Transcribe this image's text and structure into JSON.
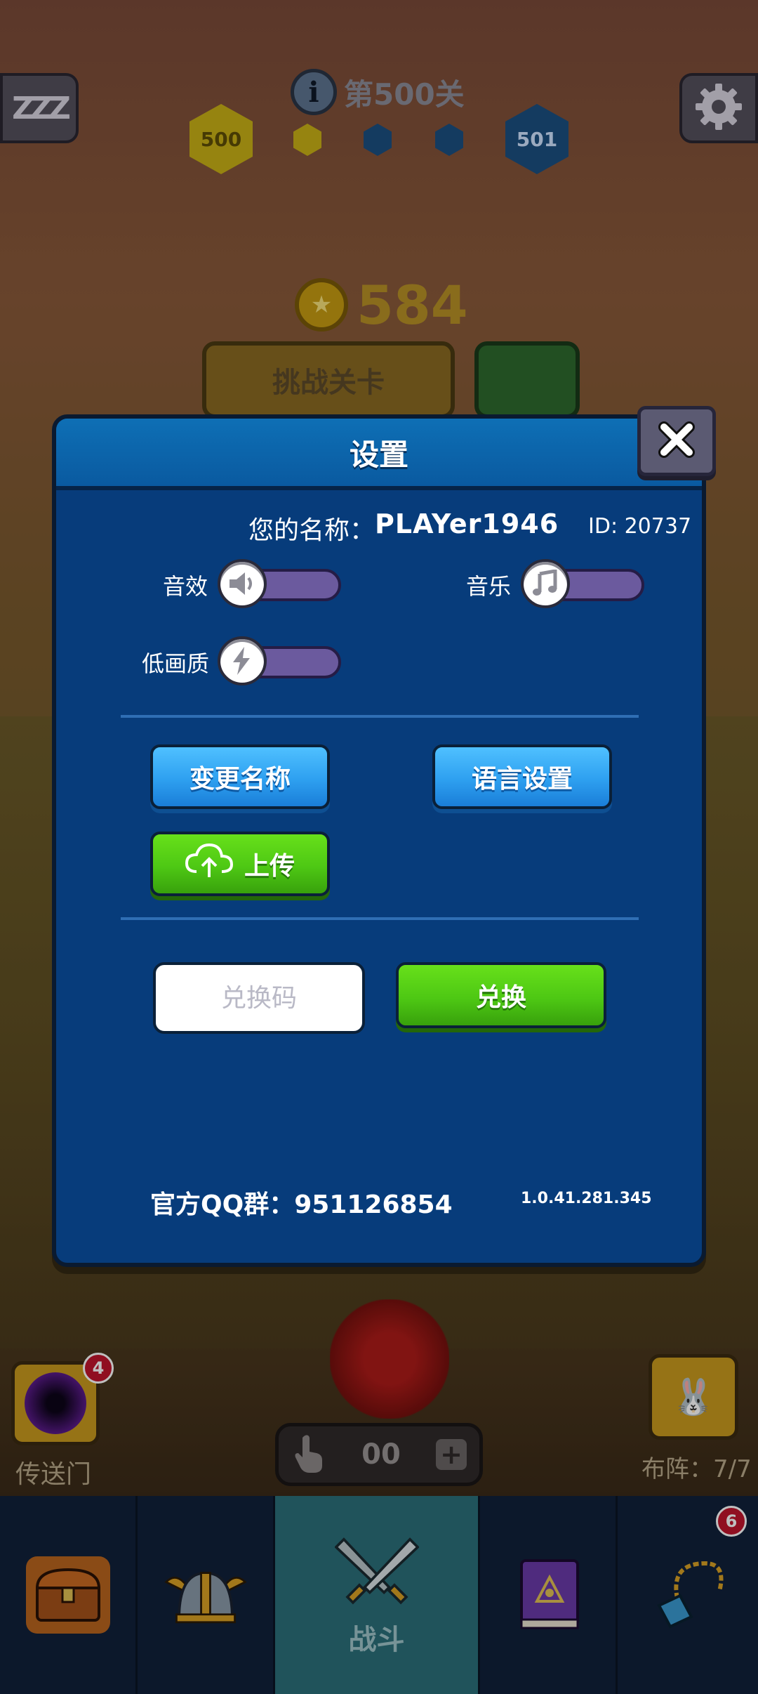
{
  "hud": {
    "level_info_icon": "i",
    "level_text": "第500关",
    "current_level": "500",
    "next_level": "501",
    "sleep_icon_text": "ZZZ"
  },
  "scene": {
    "gold_value": "584",
    "challenge_label": "挑战关卡",
    "portal_label": "传送门",
    "portal_badge": "4",
    "lineup_label": "布阵：7/7",
    "tap_count": "00"
  },
  "dialog": {
    "title": "设置",
    "name_label": "您的名称：",
    "name_value": "PLAYer1946",
    "id_text": "ID:  20737",
    "sound_label": "音效",
    "music_label": "音乐",
    "low_quality_label": "低画质",
    "change_name_button": "变更名称",
    "language_button": "语言设置",
    "upload_button": "上传",
    "code_placeholder": "兑换码",
    "redeem_button": "兑换",
    "qq_label": "官方QQ群：",
    "qq_number": "951126854",
    "version": "1.0.41.281.345"
  },
  "nav": {
    "battle_label": "战斗",
    "necklace_badge": "6"
  },
  "colors": {
    "dialog_bg": "#073c7b",
    "header_bg": "#0e6fb5",
    "blue_button": "#2ea0f0",
    "green_button": "#4ec814",
    "toggle_track": "#6b5a9e"
  }
}
